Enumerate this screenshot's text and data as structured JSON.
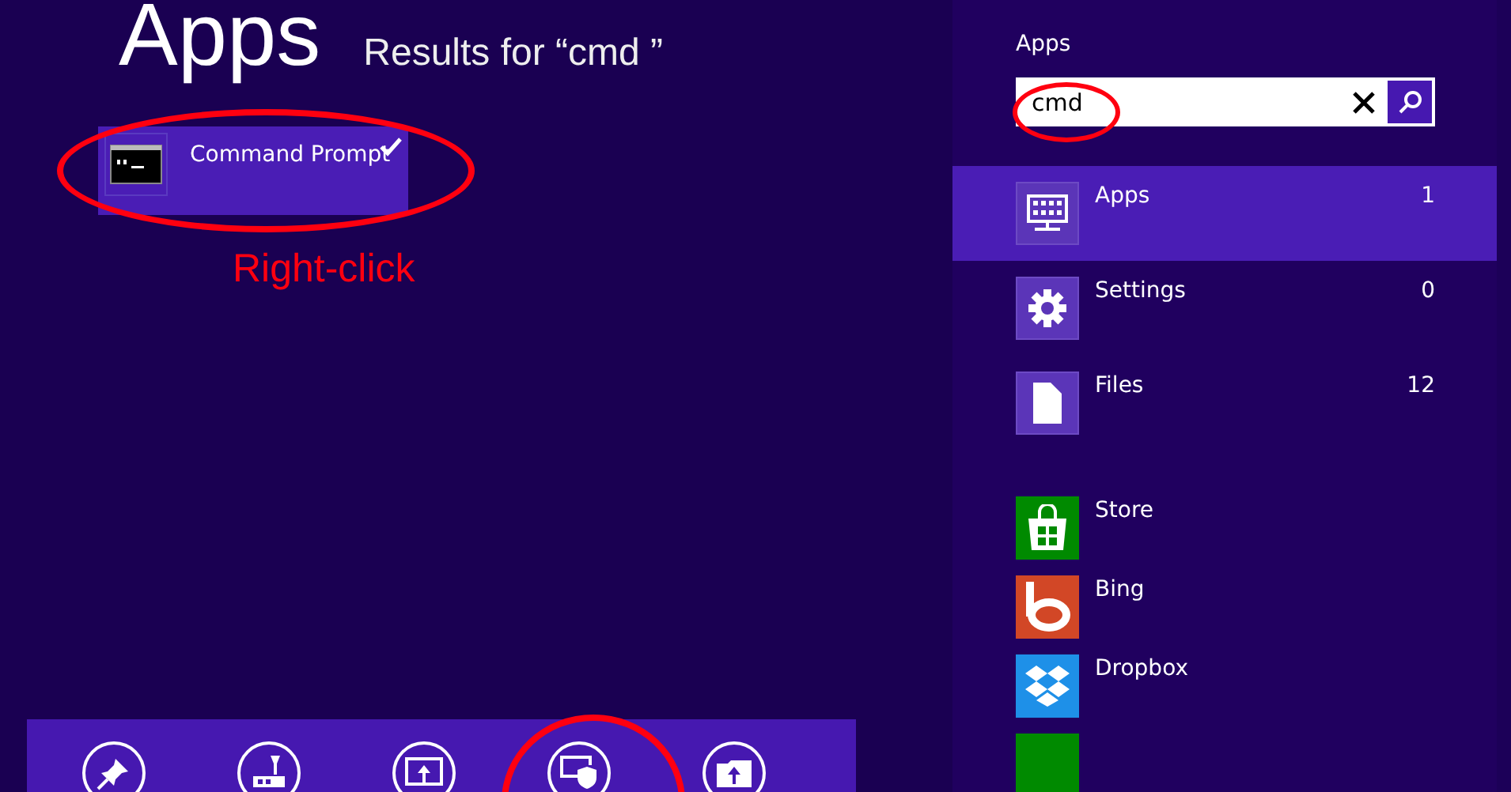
{
  "header": {
    "title": "Apps",
    "subtitle": "Results for “cmd ”"
  },
  "results": [
    {
      "label": "Command Prompt",
      "selected": true,
      "kind": "console"
    }
  ],
  "annotations": [
    {
      "kind": "ellipse-result"
    },
    {
      "kind": "text",
      "text": "Right-click"
    },
    {
      "kind": "ellipse-search"
    },
    {
      "kind": "ellipse-appbar"
    }
  ],
  "search_panel": {
    "title": "Apps",
    "search": {
      "value": "cmd"
    },
    "categories": [
      {
        "label": "Apps",
        "count": "1",
        "selected": true,
        "kind": "apps"
      },
      {
        "label": "Settings",
        "count": "0",
        "selected": false,
        "kind": "settings"
      },
      {
        "label": "Files",
        "count": "12",
        "selected": false,
        "kind": "files"
      }
    ],
    "apps": [
      {
        "label": "Store",
        "kind": "store",
        "color": "#008a00"
      },
      {
        "label": "Bing",
        "kind": "bing",
        "color": "#d24726"
      },
      {
        "label": "Dropbox",
        "kind": "dropbox",
        "color": "#1e90e8"
      },
      {
        "kind": "blank",
        "color": "#008a00"
      }
    ]
  },
  "app_bar": {
    "buttons": [
      {
        "kind": "pin"
      },
      {
        "kind": "pin-taskbar"
      },
      {
        "kind": "new-window"
      },
      {
        "kind": "run-admin"
      },
      {
        "kind": "open-location"
      }
    ]
  }
}
